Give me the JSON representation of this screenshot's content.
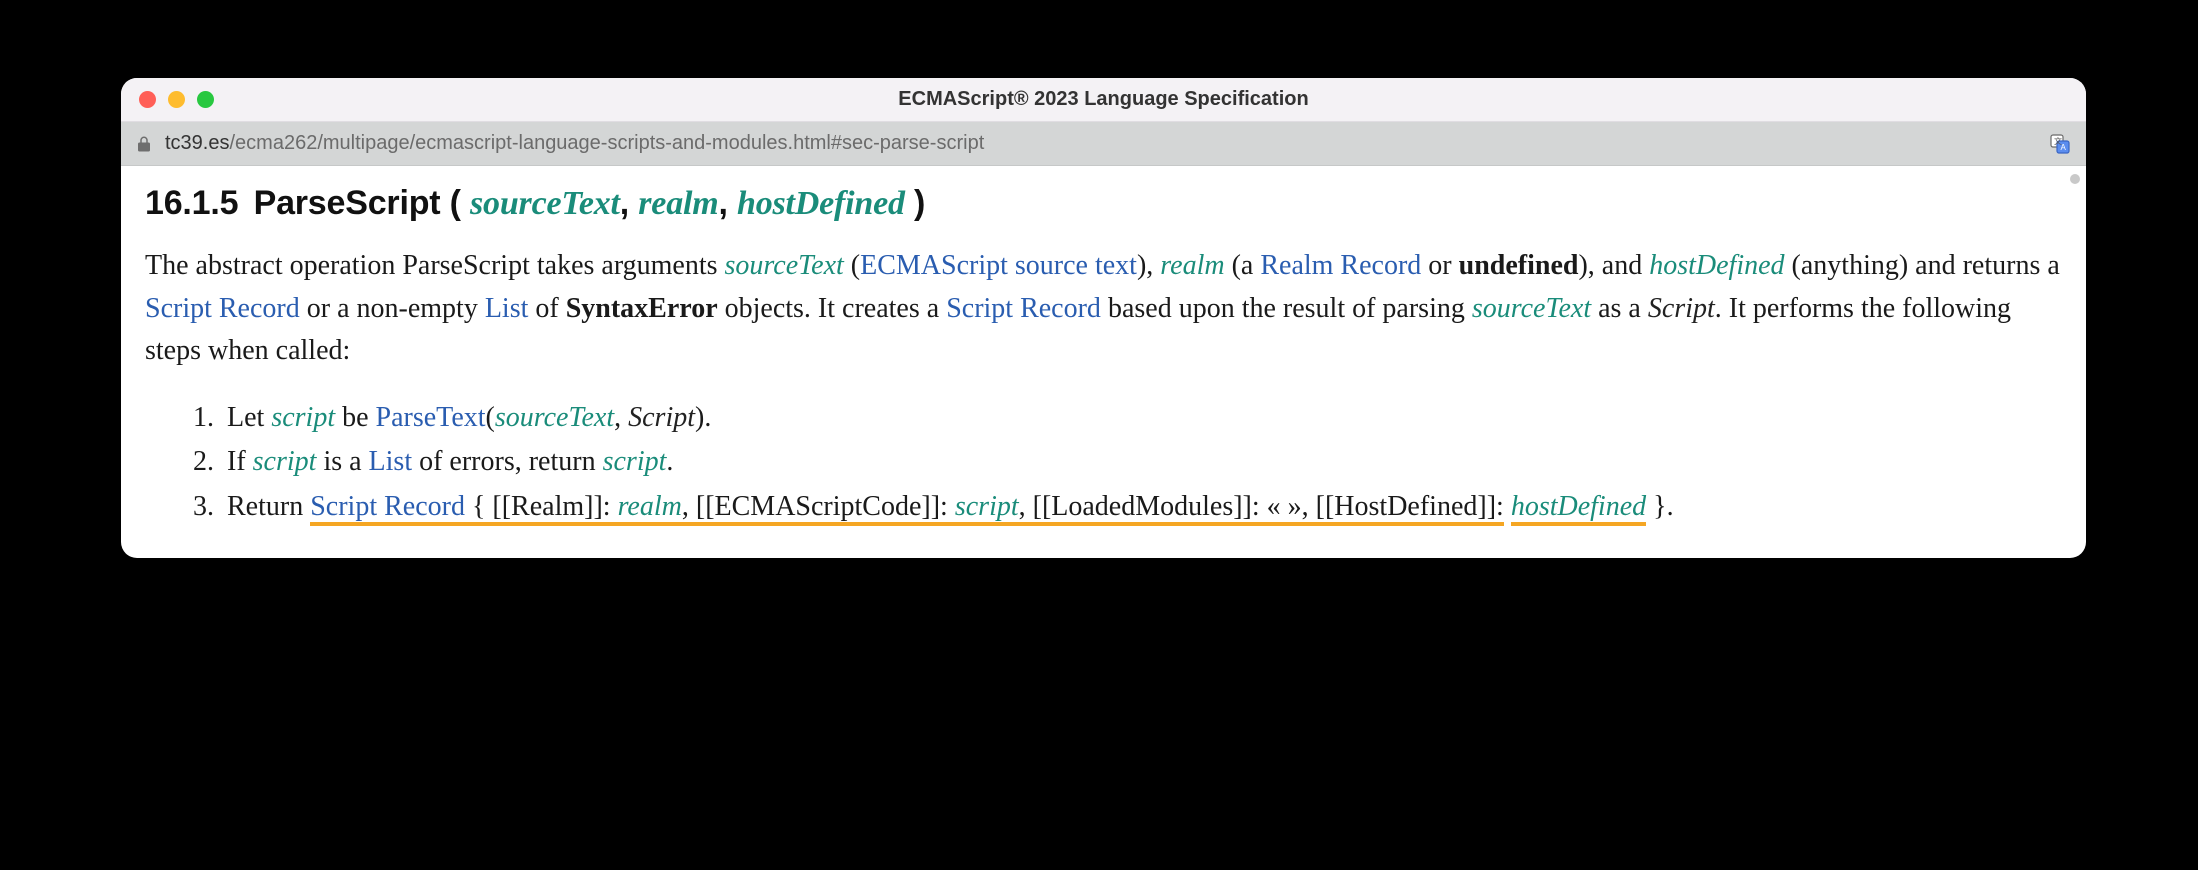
{
  "window": {
    "title": "ECMAScript® 2023 Language Specification",
    "url_domain": "tc39.es",
    "url_path": "/ecma262/multipage/ecmascript-language-scripts-and-modules.html#sec-parse-script"
  },
  "heading": {
    "secnum": "16.1.5",
    "name": "ParseScript",
    "open": " ( ",
    "arg1": "sourceText",
    "c1": ", ",
    "arg2": "realm",
    "c2": ", ",
    "arg3": "hostDefined",
    "close": " )"
  },
  "para": {
    "t1": "The abstract operation ParseScript takes arguments ",
    "v_sourceText": "sourceText",
    "t2": " (",
    "link_ecma_src": "ECMAScript source text",
    "t3": "), ",
    "v_realm": "realm",
    "t4": " (a ",
    "link_realm_record": "Realm Record",
    "t5": " or ",
    "b_undefined": "undefined",
    "t6": "), and ",
    "v_hostDefined": "hostDefined",
    "t7": " (anything) and returns a ",
    "link_script_record1": "Script Record",
    "t8": " or a non-empty ",
    "link_list1": "List",
    "t9": " of ",
    "b_syntaxerror": "SyntaxError",
    "t10": " objects. It creates a ",
    "link_script_record2": "Script Record",
    "t11": " based upon the result of parsing ",
    "v_sourceText2": "sourceText",
    "t12": " as a ",
    "nt_script": "Script",
    "t13": ". It performs the following steps when called:"
  },
  "steps": {
    "s1": {
      "t1": "Let ",
      "v_script": "script",
      "t2": " be ",
      "link_parsetext": "ParseText",
      "t3": "(",
      "v_sourceText": "sourceText",
      "t4": ", ",
      "nt_script": "Script",
      "t5": ")."
    },
    "s2": {
      "t1": "If ",
      "v_script": "script",
      "t2": " is a ",
      "link_list": "List",
      "t3": " of errors, return ",
      "v_script2": "script",
      "t4": "."
    },
    "s3": {
      "t1": "Return ",
      "link_script_record": "Script Record",
      "t2": " { [[Realm]]: ",
      "v_realm": "realm",
      "t3": ", [[ECMAScriptCode]]: ",
      "v_script": "script",
      "t4": ", [[LoadedModules]]: « », [[HostDefined]]:",
      "t5": " ",
      "v_hostDefined": "hostDefined",
      "t6": " }."
    }
  }
}
